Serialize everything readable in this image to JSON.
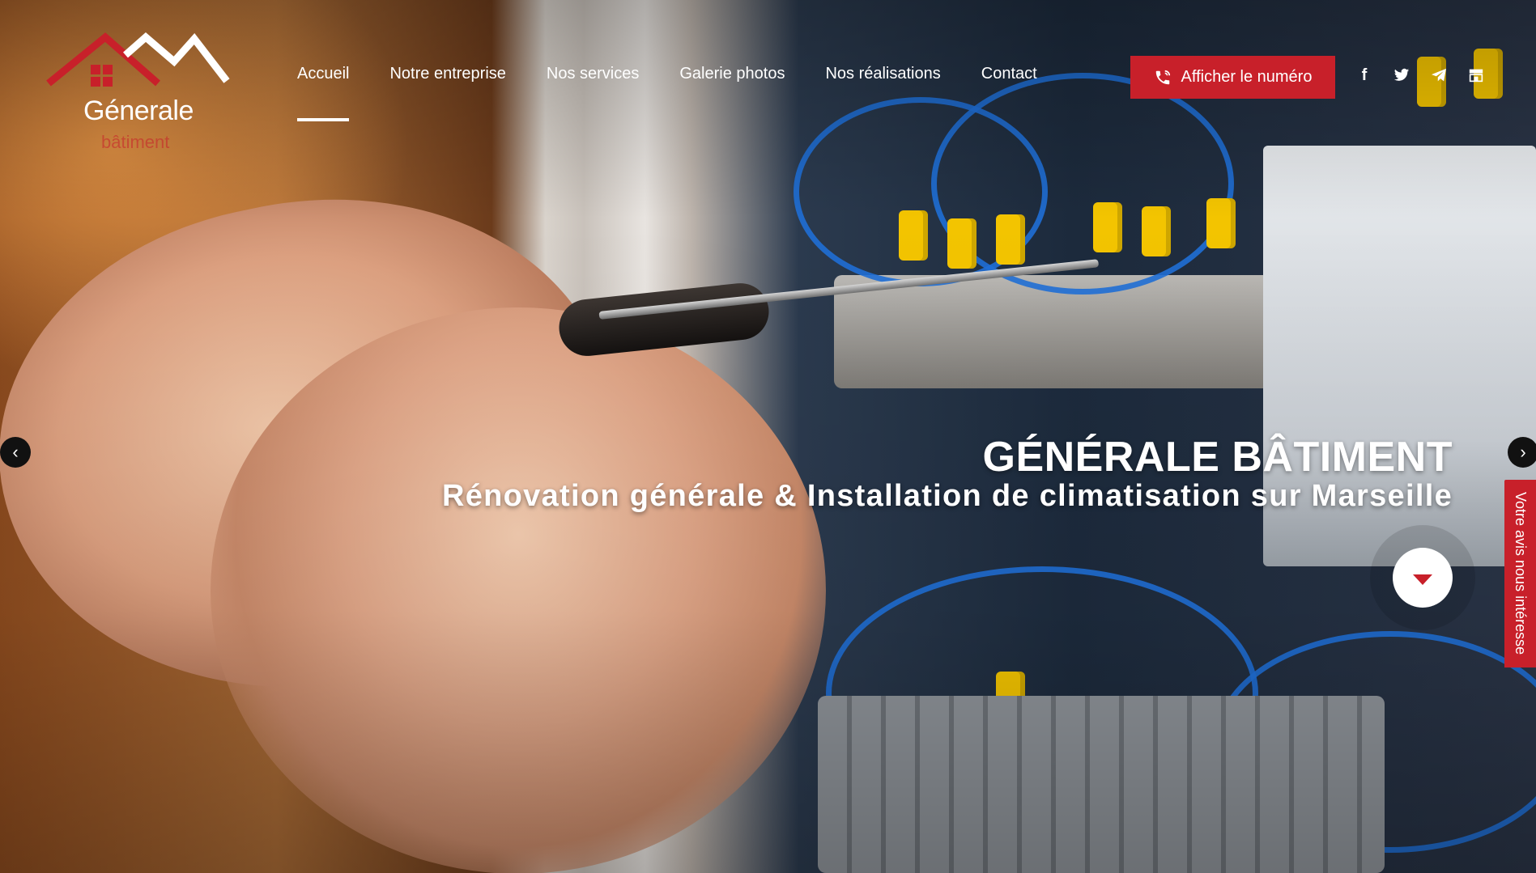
{
  "brand": {
    "name": "Génerale",
    "tagline": "bâtiment",
    "accent_color": "#c8202a"
  },
  "nav": {
    "items": [
      {
        "label": "Accueil",
        "active": true
      },
      {
        "label": "Notre entreprise",
        "active": false
      },
      {
        "label": "Nos services",
        "active": false
      },
      {
        "label": "Galerie photos",
        "active": false
      },
      {
        "label": "Nos réalisations",
        "active": false
      },
      {
        "label": "Contact",
        "active": false
      }
    ],
    "phone_button_label": "Afficher le numéro",
    "phone_icon": "phone-icon"
  },
  "socials": [
    {
      "name": "facebook-icon",
      "glyph": "f"
    },
    {
      "name": "twitter-icon",
      "glyph": "🐦"
    },
    {
      "name": "telegram-icon",
      "glyph": "➤"
    },
    {
      "name": "store-icon",
      "glyph": "▦"
    }
  ],
  "hero": {
    "title": "GÉNÉRALE BÂTIMENT",
    "subtitle": "Rénovation générale & Installation de climatisation sur Marseille",
    "prev_arrow": "‹",
    "next_arrow": "›"
  },
  "feedback_tab": {
    "label": "Votre avis nous intéresse"
  }
}
